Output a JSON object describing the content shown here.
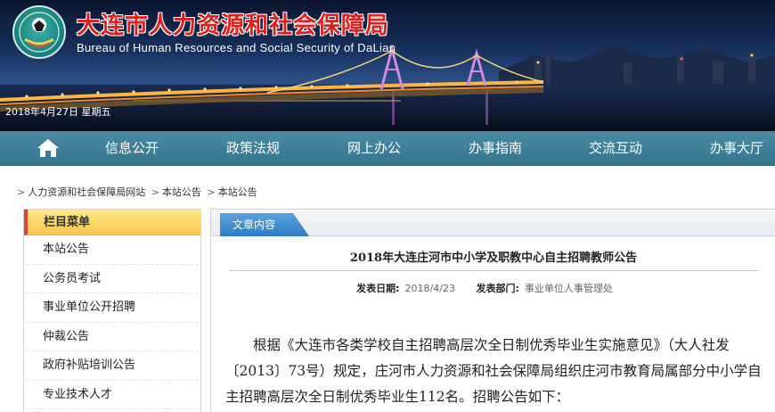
{
  "header": {
    "org_name_cn": "大连市人力资源和社会保障局",
    "org_name_en": "Bureau of Human Resources and Social Security  of  DaLian",
    "date_text": "2018年4月27日  星期五"
  },
  "nav": {
    "items": [
      {
        "label": "信息公开"
      },
      {
        "label": "政策法规"
      },
      {
        "label": "网上办公"
      },
      {
        "label": "办事指南"
      },
      {
        "label": "交流互动"
      },
      {
        "label": "办事大厅"
      }
    ]
  },
  "breadcrumb": {
    "items": [
      "人力资源和社会保障局网站",
      "本站公告",
      "本站公告"
    ]
  },
  "sidebar": {
    "title": "栏目菜单",
    "items": [
      {
        "label": "本站公告"
      },
      {
        "label": "公务员考试"
      },
      {
        "label": "事业单位公开招聘"
      },
      {
        "label": "仲裁公告"
      },
      {
        "label": "政府补贴培训公告"
      },
      {
        "label": "专业技术人才"
      }
    ]
  },
  "article": {
    "tab_label": "文章内容",
    "title": "2018年大连庄河市中小学及职教中心自主招聘教师公告",
    "meta": {
      "date_label": "发表日期:",
      "date_value": "2018/4/23",
      "dept_label": "发表部门:",
      "dept_value": "事业单位人事管理处"
    },
    "body": "根据《大连市各类学校自主招聘高层次全日制优秀毕业生实施意见》（大人社发〔2013〕73号）规定，庄河市人力资源和社会保障局组织庄河市教育局属部分中小学自主招聘高层次全日制优秀毕业生112名。招聘公告如下："
  },
  "colors": {
    "nav_bg": "#3f7f97",
    "title_red": "#e0201c",
    "sidebar_head": "#f7c94a",
    "tab_blue": "#2e7cc1"
  },
  "icons": {
    "home": "home-icon",
    "emblem": "emblem-logo"
  }
}
